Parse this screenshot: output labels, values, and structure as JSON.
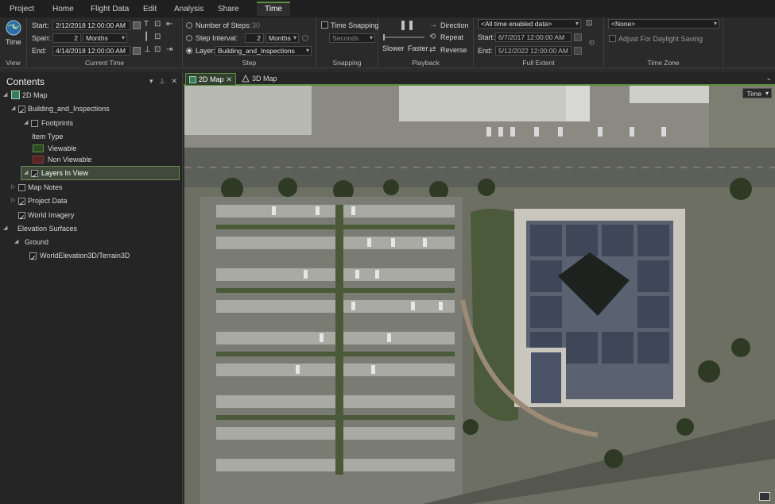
{
  "ribbon_tabs": [
    "Project",
    "Home",
    "Flight Data",
    "Edit",
    "Analysis",
    "Share",
    "Time"
  ],
  "view_group": {
    "button_label": "Time",
    "group_label": "View"
  },
  "current_time": {
    "group_label": "Current Time",
    "start_label": "Start:",
    "start_value": "2/12/2018 12:00:00 AM",
    "span_label": "Span:",
    "span_value": "2",
    "span_unit": "Months",
    "end_label": "End:",
    "end_value": "4/14/2018 12:00:00 AM"
  },
  "step": {
    "group_label": "Step",
    "num_steps_label": "Number of Steps:",
    "num_steps_value": "30",
    "interval_label": "Step Interval:",
    "interval_value": "2",
    "interval_unit": "Months",
    "layer_label": "Layer:",
    "layer_value": "Building_and_Inspections"
  },
  "snapping": {
    "group_label": "Snapping",
    "checkbox_label": "Time Snapping",
    "unit": "Seconds"
  },
  "playback": {
    "group_label": "Playback",
    "slower": "Slower",
    "faster": "Faster",
    "direction": "Direction",
    "repeat": "Repeat",
    "reverse": "Reverse"
  },
  "full_extent": {
    "group_label": "Full Extent",
    "source": "<All time enabled data>",
    "start_label": "Start:",
    "start_value": "6/7/2017 12:00:00 AM",
    "end_label": "End:",
    "end_value": "5/12/2022 12:00:00 AM"
  },
  "time_zone": {
    "group_label": "Time Zone",
    "value": "<None>",
    "dst_label": "Adjust For Daylight Saving"
  },
  "contents": {
    "title": "Contents",
    "items": [
      {
        "label": "2D Map"
      },
      {
        "label": "Building_and_Inspections"
      },
      {
        "label": "Footprints"
      },
      {
        "label": "Item Type"
      },
      {
        "label": "Viewable"
      },
      {
        "label": "Non Viewable"
      },
      {
        "label": "Layers In View"
      },
      {
        "label": "Map Notes"
      },
      {
        "label": "Project Data"
      },
      {
        "label": "World Imagery"
      },
      {
        "label": "Elevation Surfaces"
      },
      {
        "label": "Ground"
      },
      {
        "label": "WorldElevation3D/Terrain3D"
      }
    ]
  },
  "view_tabs": [
    "2D Map",
    "3D Map"
  ],
  "map": {
    "time_button": "Time"
  },
  "colors": {
    "accent": "#5b8f3e",
    "viewable": "#3f6a2e",
    "non_viewable": "#7a2f2f"
  }
}
